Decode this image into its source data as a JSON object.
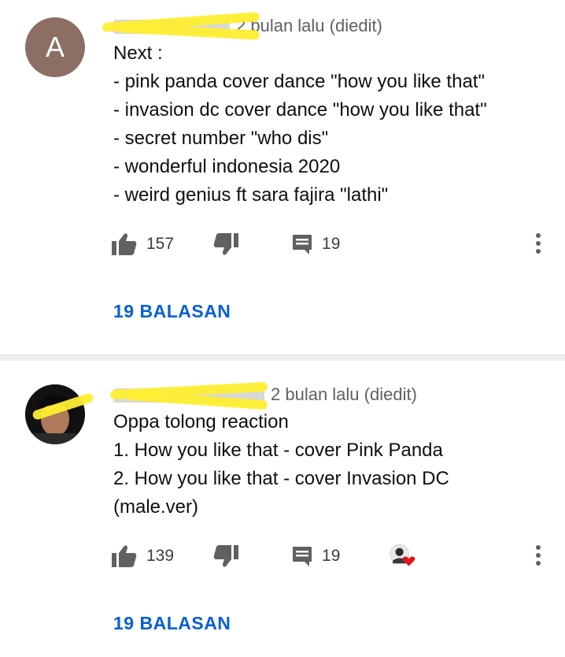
{
  "comments": [
    {
      "avatar_letter": "A",
      "time": "2 bulan lalu (diedit)",
      "lines": [
        "Next :",
        "- pink panda cover dance \"how you like that\"",
        "- invasion dc cover dance \"how you like that\"",
        "- secret number \"who dis\"",
        "- wonderful indonesia 2020",
        "- weird genius ft sara fajira \"lathi\""
      ],
      "likes": "157",
      "reply_count": "19",
      "replies_label": "19 BALASAN"
    },
    {
      "time": "2 bulan lalu (diedit)",
      "lines": [
        "Oppa tolong reaction",
        "1. How you like that - cover Pink Panda",
        "2. How you like that - cover Invasion DC (male.ver)"
      ],
      "likes": "139",
      "reply_count": "19",
      "replies_label": "19 BALASAN"
    }
  ],
  "icons": {
    "like": "thumb-up-icon",
    "dislike": "thumb-down-icon",
    "reply": "comment-icon",
    "more": "more-vertical-icon",
    "creator_heart": "creator-heart-icon"
  },
  "colors": {
    "link": "#065fd4",
    "meta": "#606060",
    "redaction": "#ffee33"
  }
}
